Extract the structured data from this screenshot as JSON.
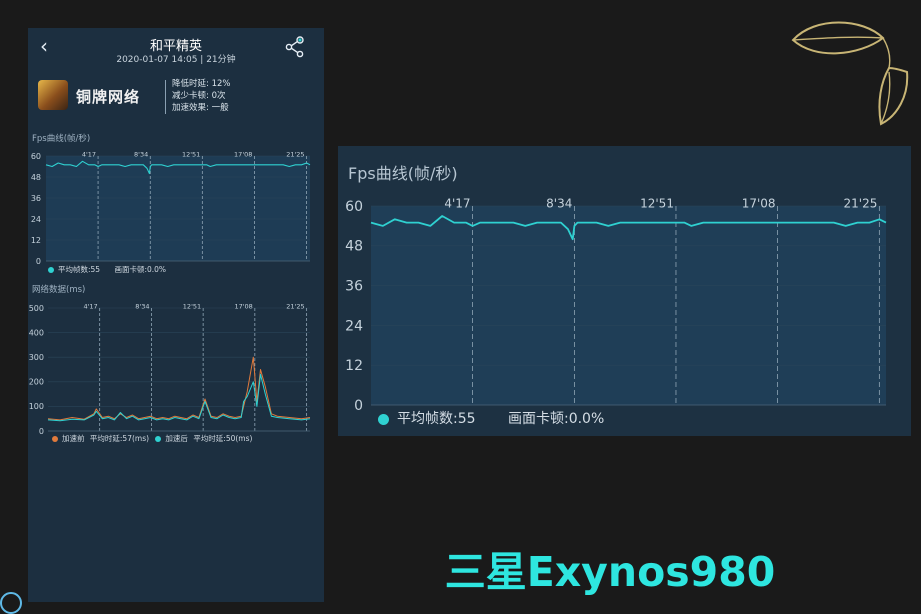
{
  "header": {
    "title": "和平精英",
    "subtitle": "2020-01-07 14:05 | 21分钟"
  },
  "profile": {
    "tier": "铜牌网络",
    "stats": [
      "降低时延: 12%",
      "减少卡顿: 0次",
      "加速效果: 一般"
    ]
  },
  "fps_section": {
    "label": "Fps曲线(帧/秒)"
  },
  "fps_legend": {
    "avg": "平均帧数:55",
    "stutter": "画面卡顿:0.0%"
  },
  "net_section": {
    "label": "网络数据(ms)"
  },
  "net_legend": {
    "before": "加速前",
    "before_latency": "平均时延:57(ms)",
    "after": "加速后",
    "after_latency": "平均时延:50(ms)"
  },
  "zoom_title": "Fps曲线(帧/秒)",
  "caption": "三星Exynos980",
  "colors": {
    "fps_line": "#2fd1d1",
    "net_before": "#e07a3c",
    "net_after": "#2fd1d1",
    "caption": "#2ee6e0"
  },
  "chart_data": [
    {
      "type": "line",
      "title": "Fps曲线(帧/秒)",
      "xlabel": "",
      "ylabel": "",
      "ylim": [
        0,
        60
      ],
      "yticks": [
        0,
        12,
        24,
        36,
        48,
        60
      ],
      "xlim": [
        0,
        21.7
      ],
      "x_markers": [
        4.28,
        8.57,
        12.85,
        17.13,
        21.42
      ],
      "x_marker_labels": [
        "4'17",
        "8'34",
        "12'51",
        "17'08",
        "21'25"
      ],
      "series": [
        {
          "x": [
            0,
            0.5,
            1,
            1.5,
            2,
            2.5,
            3,
            3.5,
            4,
            4.28,
            4.6,
            5,
            5.5,
            6,
            6.5,
            7,
            7.5,
            8,
            8.3,
            8.5,
            8.57,
            8.7,
            9,
            9.5,
            10,
            10.5,
            11,
            11.5,
            12,
            12.5,
            12.85,
            13.2,
            13.5,
            14,
            14.5,
            15,
            15.5,
            16,
            16.5,
            17,
            17.13,
            17.5,
            18,
            18.5,
            19,
            19.5,
            20,
            20.5,
            21,
            21.42,
            21.7
          ],
          "y": [
            55,
            54,
            56,
            55,
            55,
            54,
            57,
            55,
            55,
            54,
            55,
            55,
            55,
            55,
            54,
            55,
            55,
            55,
            53,
            50,
            54,
            55,
            55,
            55,
            54,
            55,
            55,
            55,
            55,
            55,
            55,
            55,
            54,
            55,
            55,
            55,
            55,
            55,
            55,
            55,
            55,
            55,
            55,
            55,
            55,
            55,
            54,
            55,
            55,
            56,
            55
          ]
        }
      ],
      "legend": [
        "平均帧数:55",
        "画面卡顿:0.0%"
      ]
    },
    {
      "type": "line",
      "title": "网络数据(ms)",
      "ylim": [
        0,
        500
      ],
      "yticks": [
        0,
        100,
        200,
        300,
        400,
        500
      ],
      "xlim": [
        0,
        21.7
      ],
      "x_markers": [
        4.28,
        8.57,
        12.85,
        17.13,
        21.42
      ],
      "x_marker_labels": [
        "4'17",
        "8'34",
        "12'51",
        "17'08",
        "21'25"
      ],
      "series": [
        {
          "name": "加速前",
          "x": [
            0,
            1,
            2,
            3,
            3.8,
            4,
            4.5,
            5,
            5.5,
            6,
            6.5,
            7,
            7.5,
            8,
            8.5,
            9,
            9.5,
            10,
            10.5,
            11,
            11.5,
            12,
            12.5,
            13,
            13.5,
            14,
            14.5,
            15,
            15.5,
            16,
            16.2,
            16.5,
            17,
            17.3,
            17.6,
            18,
            18.5,
            19,
            20,
            21,
            21.7
          ],
          "y": [
            50,
            45,
            55,
            48,
            70,
            90,
            55,
            60,
            50,
            70,
            55,
            65,
            50,
            55,
            60,
            50,
            55,
            50,
            60,
            55,
            50,
            65,
            55,
            130,
            60,
            55,
            70,
            60,
            55,
            60,
            100,
            160,
            300,
            120,
            250,
            180,
            70,
            60,
            55,
            50,
            55
          ]
        },
        {
          "name": "加速后",
          "x": [
            0,
            1,
            2,
            3,
            3.8,
            4,
            4.5,
            5,
            5.5,
            6,
            6.5,
            7,
            7.5,
            8,
            8.5,
            9,
            9.5,
            10,
            10.5,
            11,
            11.5,
            12,
            12.5,
            13,
            13.5,
            14,
            14.5,
            15,
            15.5,
            16,
            16.2,
            16.5,
            17,
            17.3,
            17.6,
            18,
            18.5,
            19,
            20,
            21,
            21.7
          ],
          "y": [
            45,
            42,
            48,
            45,
            65,
            80,
            50,
            55,
            45,
            75,
            50,
            60,
            45,
            50,
            55,
            45,
            50,
            45,
            55,
            50,
            45,
            60,
            50,
            120,
            55,
            50,
            65,
            55,
            50,
            55,
            120,
            140,
            200,
            100,
            230,
            150,
            60,
            55,
            50,
            45,
            50
          ]
        }
      ],
      "legend": [
        "加速前 平均时延:57(ms)",
        "加速后 平均时延:50(ms)"
      ]
    }
  ]
}
